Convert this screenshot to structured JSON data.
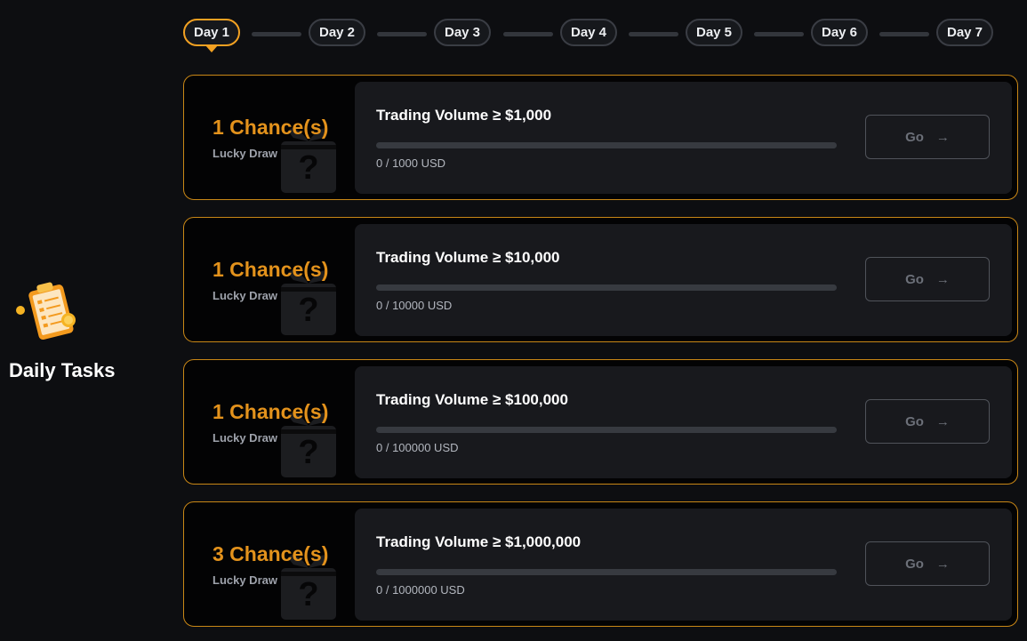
{
  "page": {
    "title": "Daily Tasks"
  },
  "days": [
    {
      "label": "Day 1",
      "active": true
    },
    {
      "label": "Day 2",
      "active": false
    },
    {
      "label": "Day 3",
      "active": false
    },
    {
      "label": "Day 4",
      "active": false
    },
    {
      "label": "Day 5",
      "active": false
    },
    {
      "label": "Day 6",
      "active": false
    },
    {
      "label": "Day 7",
      "active": false
    }
  ],
  "tasks": [
    {
      "reward": "1 Chance(s)",
      "reward_type": "Lucky Draw",
      "title": "Trading Volume ≥ $1,000",
      "progress_text": "0 / 1000 USD",
      "progress": 0,
      "button": "Go"
    },
    {
      "reward": "1 Chance(s)",
      "reward_type": "Lucky Draw",
      "title": "Trading Volume ≥ $10,000",
      "progress_text": "0 / 10000 USD",
      "progress": 0,
      "button": "Go"
    },
    {
      "reward": "1 Chance(s)",
      "reward_type": "Lucky Draw",
      "title": "Trading Volume ≥ $100,000",
      "progress_text": "0 / 100000 USD",
      "progress": 0,
      "button": "Go"
    },
    {
      "reward": "3 Chance(s)",
      "reward_type": "Lucky Draw",
      "title": "Trading Volume ≥ $1,000,000",
      "progress_text": "0 / 1000000 USD",
      "progress": 0,
      "button": "Go"
    }
  ],
  "icons": {
    "section": "clipboard-checklist-icon",
    "reward": "mystery-gift-icon",
    "go": "arrow-right-icon"
  },
  "colors": {
    "accent": "#f2a122",
    "reward": "#e3921c",
    "background": "#0d0e11",
    "card": "#18191d"
  }
}
